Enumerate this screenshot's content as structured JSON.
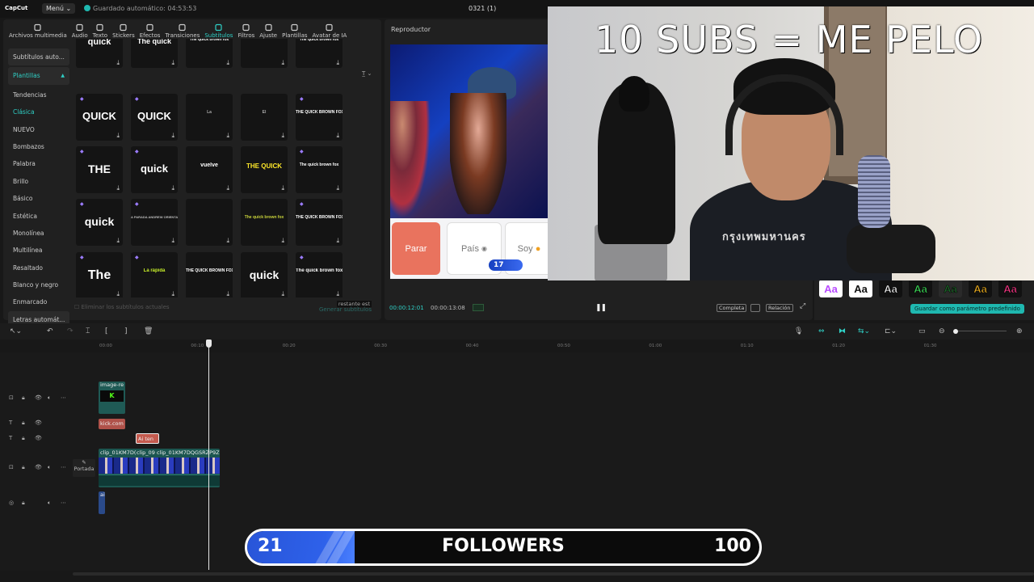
{
  "app": {
    "logo": "CapCut",
    "menu_label": "Menú",
    "autosave_text": "Guardado automático: 04:53:53",
    "project_title": "0321 (1)",
    "accent": "#2fd0c6"
  },
  "toolbar": {
    "tabs": [
      {
        "label": "Archivos multimedia",
        "icon": "media-icon"
      },
      {
        "label": "Audio",
        "icon": "audio-icon"
      },
      {
        "label": "Texto",
        "icon": "text-icon"
      },
      {
        "label": "Stickers",
        "icon": "sticker-icon"
      },
      {
        "label": "Efectos",
        "icon": "effects-icon"
      },
      {
        "label": "Transiciones",
        "icon": "transitions-icon"
      },
      {
        "label": "Subtítulos",
        "icon": "subtitles-icon",
        "active": true
      },
      {
        "label": "Filtros",
        "icon": "filters-icon"
      },
      {
        "label": "Ajuste",
        "icon": "adjust-icon"
      },
      {
        "label": "Plantillas",
        "icon": "templates-icon"
      },
      {
        "label": "Avatar de IA",
        "icon": "avatar-icon"
      }
    ]
  },
  "subtitle_nav": {
    "items": [
      "Subtítulos auto...",
      "Plantillas",
      "Tendencias",
      "Clásica",
      "NUEVO",
      "Bombazos",
      "Palabra",
      "Brillo",
      "Básico",
      "Estética",
      "Monolínea",
      "Multilínea",
      "Resaltado",
      "Blanco y negro",
      "Enmarcado",
      "Letras automát..."
    ]
  },
  "templates": {
    "filter_icon": "text-filter-icon",
    "rows": [
      [
        "quick",
        "The quick",
        "The quick brown fox",
        "",
        "The quick brown fox"
      ],
      [
        "QUICK",
        "QUICK",
        "La",
        "El",
        "THE QUICK BROWN FOX"
      ],
      [
        "THE",
        "quick",
        "vuelve",
        "THE QUICK",
        "The quick brown fox"
      ],
      [
        "quick",
        "A PARADA ANDREW ORIENTAL",
        "",
        "The quick brown fox",
        "THE QUICK BROWN FOX"
      ],
      [
        "The",
        "La rápida",
        "THE QUICK BROWN FOX",
        "quick",
        "The quick brown fox"
      ]
    ],
    "footer_hint": "restante est",
    "footer_label": "Eliminar los subtítulos actuales",
    "generate_label": "Generar subtítulos"
  },
  "player": {
    "header": "Reproductor",
    "cards": [
      "Parar",
      "País",
      "Soy"
    ],
    "badge": "17",
    "current_time": "00:00:12:01",
    "total_time": "00:00:13:08",
    "btn_full": "Completa",
    "btn_ratio": "Relación"
  },
  "overlay": {
    "title": "10 SUBS = ME PELO",
    "shirt_text": "กรุงเทพมหานคร"
  },
  "styles": {
    "presets": [
      {
        "label": "Aa",
        "color": "#b84bff",
        "bg": "#ffffff"
      },
      {
        "label": "Aa",
        "color": "#111111",
        "bg": "#ffffff"
      },
      {
        "label": "Aa",
        "color": "#ffffff",
        "bg": "#111111"
      },
      {
        "label": "Aa",
        "color": "#3ee05a",
        "bg": "#111111"
      },
      {
        "label": "Aa",
        "color": "#1d6a2a",
        "bg": "#2a2a2a"
      },
      {
        "label": "Aa",
        "color": "#f0b020",
        "bg": "#111111"
      },
      {
        "label": "Aa",
        "color": "#ff3a8a",
        "bg": "#111111"
      }
    ],
    "save_preset_label": "Guardar como parámetro predefinido"
  },
  "timeline": {
    "ruler": [
      "00:00",
      "00:10",
      "00:20",
      "00:30",
      "00:40",
      "00:50",
      "01:00",
      "01:10",
      "01:20",
      "01:30"
    ],
    "clips": {
      "image": "image-re",
      "kick": "kick.com",
      "text": "Ai ten",
      "video1": "clip_01KM7D(",
      "video2": "clip_09",
      "video3": "clip_01KM7DQGSRZP9ZSE",
      "audio": "ai"
    },
    "cover_label": "Portada"
  },
  "follower_bar": {
    "current": "21",
    "label": "FOLLOWERS",
    "goal": "100",
    "progress": 0.21,
    "fill_color": "#2e61ea"
  }
}
